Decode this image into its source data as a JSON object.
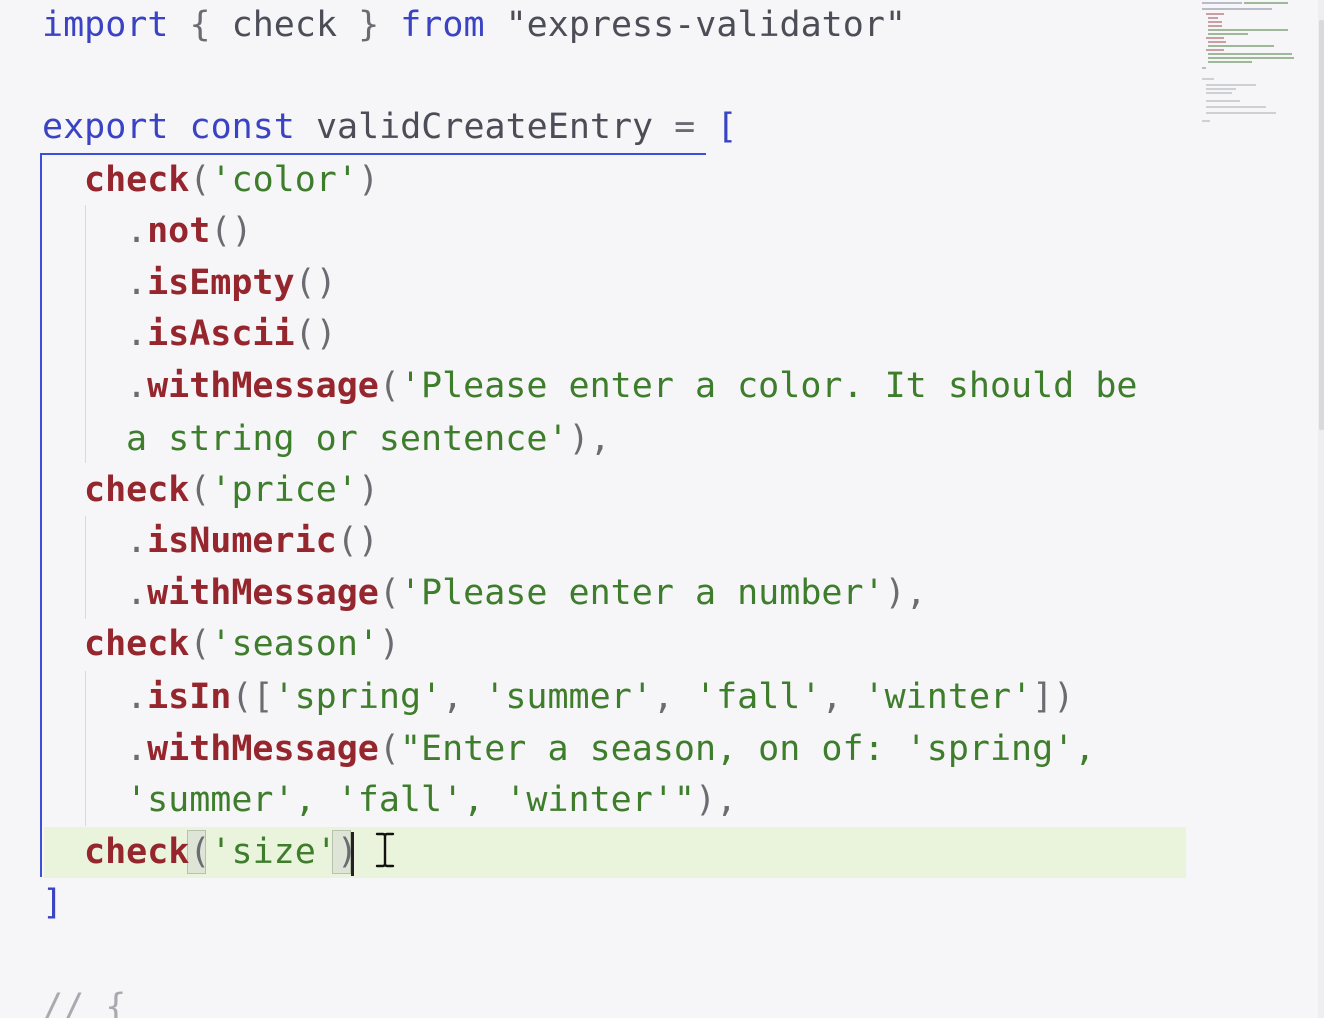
{
  "editor": {
    "lines": [
      [
        [
          "kw",
          "import"
        ],
        [
          "pun",
          " { "
        ],
        [
          "ident",
          "check"
        ],
        [
          "pun",
          " } "
        ],
        [
          "kw",
          "from"
        ],
        [
          "pun",
          " "
        ],
        [
          "ident",
          "\"express-validator\""
        ]
      ],
      [
        [
          "kw",
          "export"
        ],
        [
          "pun",
          " "
        ],
        [
          "kw",
          "const"
        ],
        [
          "pun",
          " "
        ],
        [
          "ident",
          "validCreateEntry"
        ],
        [
          "pun",
          " = "
        ],
        [
          "kw",
          "["
        ]
      ],
      [
        [
          "fn",
          "check"
        ],
        [
          "pun",
          "("
        ],
        [
          "str",
          "'color'"
        ],
        [
          "pun",
          ")"
        ]
      ],
      [
        [
          "pun",
          "."
        ],
        [
          "fn",
          "not"
        ],
        [
          "pun",
          "()"
        ]
      ],
      [
        [
          "pun",
          "."
        ],
        [
          "fn",
          "isEmpty"
        ],
        [
          "pun",
          "()"
        ]
      ],
      [
        [
          "pun",
          "."
        ],
        [
          "fn",
          "isAscii"
        ],
        [
          "pun",
          "()"
        ]
      ],
      [
        [
          "pun",
          "."
        ],
        [
          "fn",
          "withMessage"
        ],
        [
          "pun",
          "("
        ],
        [
          "str",
          "'Please enter a color. It should be"
        ]
      ],
      [
        [
          "str",
          "a string or sentence'"
        ],
        [
          "pun",
          "),"
        ]
      ],
      [
        [
          "fn",
          "check"
        ],
        [
          "pun",
          "("
        ],
        [
          "str",
          "'price'"
        ],
        [
          "pun",
          ")"
        ]
      ],
      [
        [
          "pun",
          "."
        ],
        [
          "fn",
          "isNumeric"
        ],
        [
          "pun",
          "()"
        ]
      ],
      [
        [
          "pun",
          "."
        ],
        [
          "fn",
          "withMessage"
        ],
        [
          "pun",
          "("
        ],
        [
          "str",
          "'Please enter a number'"
        ],
        [
          "pun",
          "),"
        ]
      ],
      [
        [
          "fn",
          "check"
        ],
        [
          "pun",
          "("
        ],
        [
          "str",
          "'season'"
        ],
        [
          "pun",
          ")"
        ]
      ],
      [
        [
          "pun",
          "."
        ],
        [
          "fn",
          "isIn"
        ],
        [
          "pun",
          "(["
        ],
        [
          "str",
          "'spring'"
        ],
        [
          "pun",
          ", "
        ],
        [
          "str",
          "'summer'"
        ],
        [
          "pun",
          ", "
        ],
        [
          "str",
          "'fall'"
        ],
        [
          "pun",
          ", "
        ],
        [
          "str",
          "'winter'"
        ],
        [
          "pun",
          "])"
        ]
      ],
      [
        [
          "pun",
          "."
        ],
        [
          "fn",
          "withMessage"
        ],
        [
          "pun",
          "("
        ],
        [
          "str",
          "\"Enter a season, on of: 'spring',"
        ]
      ],
      [
        [
          "str",
          "'summer', 'fall', 'winter'\""
        ],
        [
          "pun",
          "),"
        ]
      ],
      [
        [
          "fn",
          "check"
        ],
        [
          "pun",
          "("
        ],
        [
          "str",
          "'size'"
        ],
        [
          "pun",
          ")"
        ]
      ],
      [
        [
          "kw",
          "]"
        ]
      ],
      [
        [
          "cmt",
          "// {"
        ]
      ]
    ]
  },
  "icons": {
    "cursor": "i-beam-cursor-icon"
  },
  "colors": {
    "keyword": "#3a43c4",
    "function": "#96262d",
    "string": "#3e7d2b",
    "punctuation": "#6b6b72",
    "current_line": "#eaf3dc",
    "block_bracket": "#3b4fd8"
  }
}
